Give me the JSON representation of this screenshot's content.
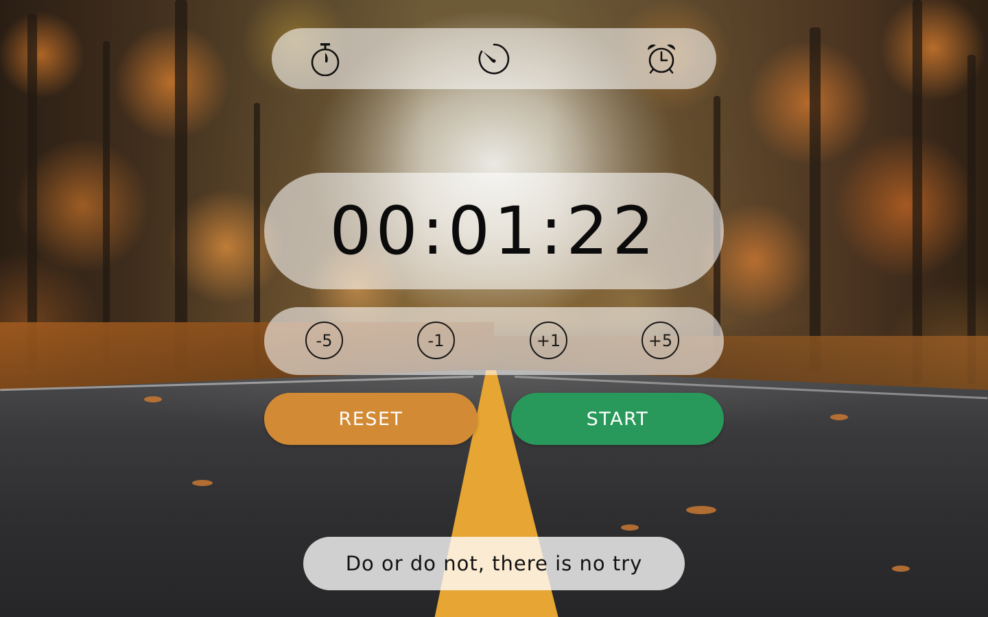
{
  "app": {
    "title": ""
  },
  "modes": [
    {
      "name": "stopwatch",
      "icon": "stopwatch-icon",
      "active": true
    },
    {
      "name": "timer",
      "icon": "timer-dial-icon",
      "active": false
    },
    {
      "name": "alarm",
      "icon": "alarm-clock-icon",
      "active": false
    }
  ],
  "timer": {
    "display": "00:01:22"
  },
  "adjust": {
    "minus_five": "-5",
    "minus_one": "-1",
    "plus_one": "+1",
    "plus_five": "+5"
  },
  "actions": {
    "reset_label": "RESET",
    "start_label": "START"
  },
  "quote": {
    "text": "Do or do not, there is no try"
  },
  "colors": {
    "reset": "#d38a35",
    "start": "#28995a",
    "panel": "rgba(255,255,255,0.58)",
    "text": "#111111"
  }
}
